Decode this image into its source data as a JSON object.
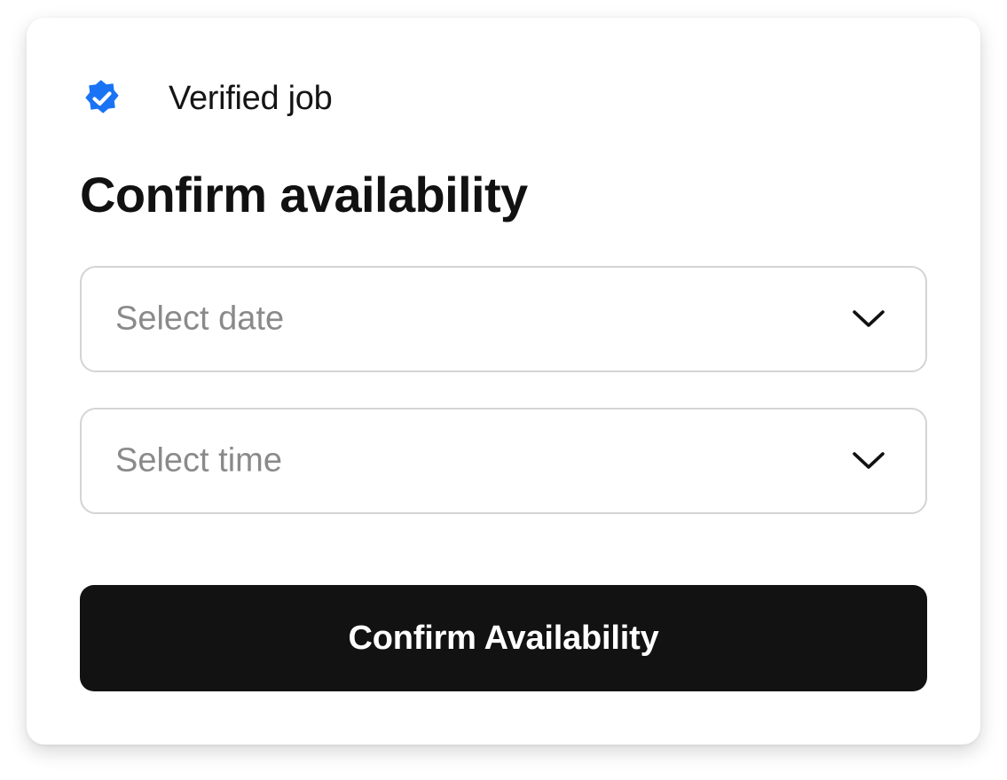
{
  "header": {
    "verified_icon": "verified-badge-icon",
    "verified_label": "Verified job",
    "title": "Confirm availability"
  },
  "form": {
    "date_select": {
      "placeholder": "Select date",
      "icon": "chevron-down-icon"
    },
    "time_select": {
      "placeholder": "Select time",
      "icon": "chevron-down-icon"
    },
    "confirm_button_label": "Confirm Availability"
  },
  "colors": {
    "badge_blue": "#1a73f4",
    "button_bg": "#121212",
    "button_text": "#ffffff",
    "placeholder_text": "#8a8a8a",
    "field_border": "#d4d4d4"
  }
}
